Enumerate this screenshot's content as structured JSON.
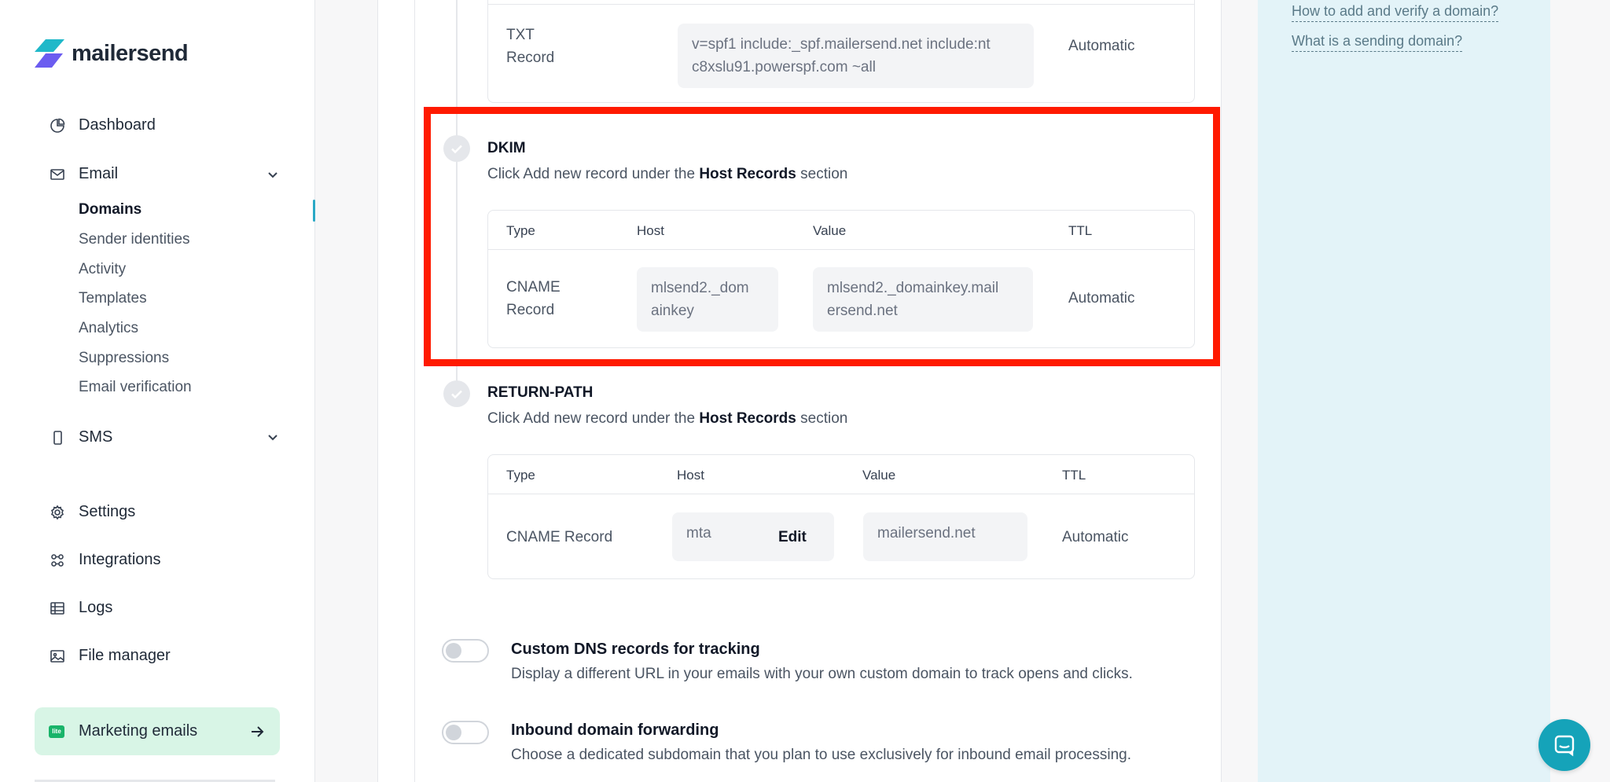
{
  "brand": {
    "name": "mailersend",
    "accent": "#2ba9c6",
    "highlight": "#ff1a00"
  },
  "sidebar": {
    "nav": [
      {
        "label": "Dashboard",
        "icon": "dashboard-icon"
      },
      {
        "label": "Email",
        "icon": "mail-icon"
      },
      {
        "label": "SMS",
        "icon": "phone-icon"
      },
      {
        "label": "Settings",
        "icon": "gear-icon"
      },
      {
        "label": "Integrations",
        "icon": "integrations-icon"
      },
      {
        "label": "Logs",
        "icon": "table-icon"
      },
      {
        "label": "File manager",
        "icon": "image-icon"
      }
    ],
    "email_sub": [
      "Domains",
      "Sender identities",
      "Activity",
      "Templates",
      "Analytics",
      "Suppressions",
      "Email verification"
    ],
    "active_sub": "Domains",
    "marketing": {
      "badge": "lite",
      "label": "Marketing emails"
    }
  },
  "spf": {
    "type_line1": "TXT",
    "type_line2": "Record",
    "value_line1": "v=spf1 include:_spf.mailersend.net include:nt",
    "value_line2": "c8xslu91.powerspf.com ~all",
    "ttl": "Automatic"
  },
  "dkim": {
    "title": "DKIM",
    "desc_pre": "Click Add new record under the ",
    "desc_bold": "Host Records",
    "desc_post": " section",
    "headers": {
      "type": "Type",
      "host": "Host",
      "value": "Value",
      "ttl": "TTL"
    },
    "row": {
      "type_line1": "CNAME",
      "type_line2": "Record",
      "host_line1": "mlsend2._dom",
      "host_line2": "ainkey",
      "value_line1": "mlsend2._domainkey.mail",
      "value_line2": "ersend.net",
      "ttl": "Automatic"
    }
  },
  "return_path": {
    "title": "RETURN-PATH",
    "desc_pre": "Click Add new record under the ",
    "desc_bold": "Host Records",
    "desc_post": " section",
    "headers": {
      "type": "Type",
      "host": "Host",
      "value": "Value",
      "ttl": "TTL"
    },
    "row": {
      "type": "CNAME Record",
      "host": "mta",
      "edit": "Edit",
      "value": "mailersend.net",
      "ttl": "Automatic"
    }
  },
  "options": [
    {
      "title": "Custom DNS records for tracking",
      "desc": "Display a different URL in your emails with your own custom domain to track opens and clicks.",
      "enabled": false
    },
    {
      "title": "Inbound domain forwarding",
      "desc": "Choose a dedicated subdomain that you plan to use exclusively for inbound email processing.",
      "enabled": false
    }
  ],
  "help_links": [
    "How to add and verify a domain?",
    "What is a sending domain?"
  ]
}
